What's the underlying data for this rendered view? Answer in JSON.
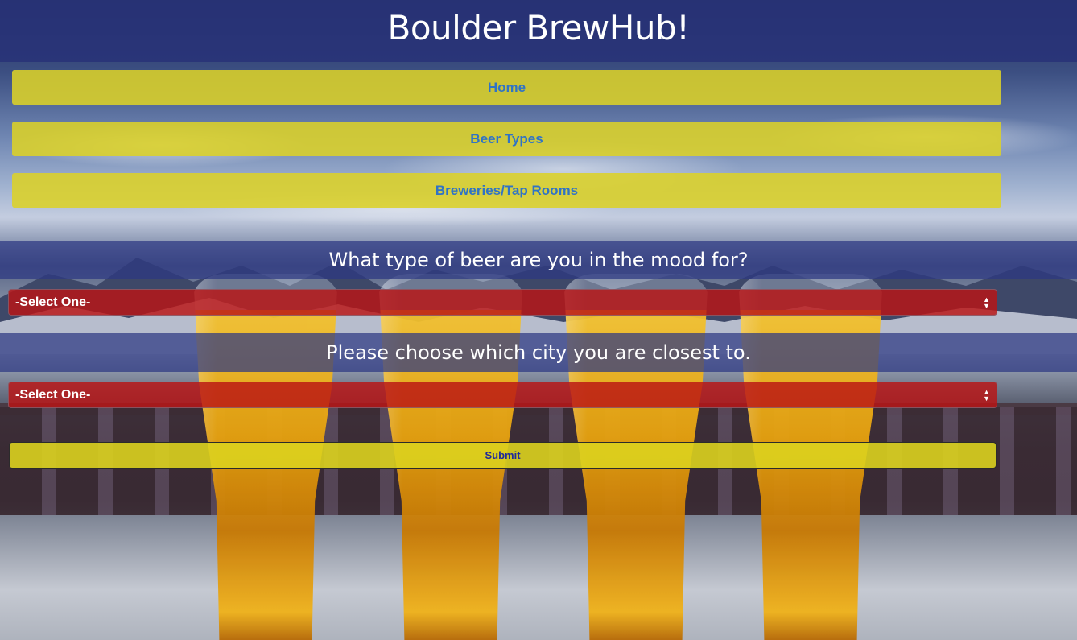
{
  "header": {
    "title": "Boulder BrewHub!"
  },
  "nav": {
    "items": [
      {
        "label": "Home"
      },
      {
        "label": "Beer Types"
      },
      {
        "label": "Breweries/Tap Rooms"
      }
    ]
  },
  "beer_question": {
    "heading": "What type of beer are you in the mood for?",
    "selected": "-Select One-"
  },
  "city_question": {
    "heading": "Please choose which city you are closest to.",
    "selected": "-Select One-"
  },
  "form": {
    "submit_label": "Submit"
  },
  "colors": {
    "header_bg": "#28327a",
    "nav_button": "#dcd228",
    "nav_text": "#2f73c6",
    "select_bg": "#b91414",
    "submit_text": "#1f2a9a"
  }
}
